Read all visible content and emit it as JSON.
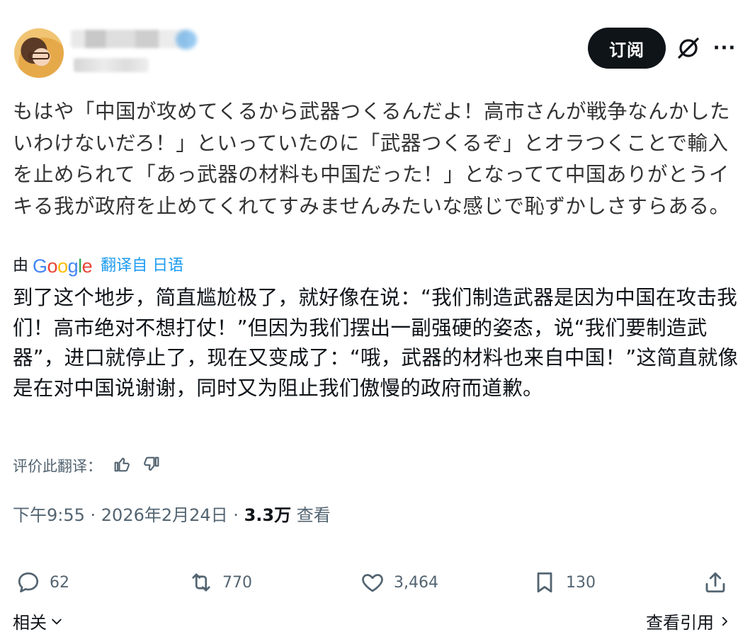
{
  "header": {
    "subscribe_label": "订阅",
    "more_label": "···"
  },
  "post": {
    "original_text": "もはや「中国が攻めてくるから武器つくるんだよ！高市さんが戦争なんかしたいわけないだろ！」といっていたのに「武器つくるぞ」とオラつくことで輸入を止められて「あっ武器の材料も中国だった！」となってて中国ありがとうイキる我が政府を止めてくれてすみませんみたいな感じで恥ずかしさすらある。",
    "translated_by_prefix": "由",
    "google_logo": "Google",
    "translate_source": "翻译自 日语",
    "translated_text": "到了这个地步，简直尴尬极了，就好像在说：“我们制造武器是因为中国在攻击我们！高市绝对不想打仗！”但因为我们摆出一副强硬的姿态，说“我们要制造武器”，进口就停止了，现在又变成了：“哦，武器的材料也来自中国！”这简直就像是在对中国说谢谢，同时又为阻止我们傲慢的政府而道歉。",
    "rate_label": "评价此翻译：",
    "time": "下午9:55 · 2026年2月24日 · ",
    "views_count": "3.3万",
    "views_label": " 查看"
  },
  "actions": {
    "replies": "62",
    "reposts": "770",
    "likes": "3,464",
    "bookmarks": "130"
  },
  "footer": {
    "related_label": "相关",
    "view_quotes_label": "查看引用"
  },
  "colors": {
    "link": "#1d9bf0",
    "secondary_text": "#536471",
    "primary_text": "#0f1419"
  }
}
